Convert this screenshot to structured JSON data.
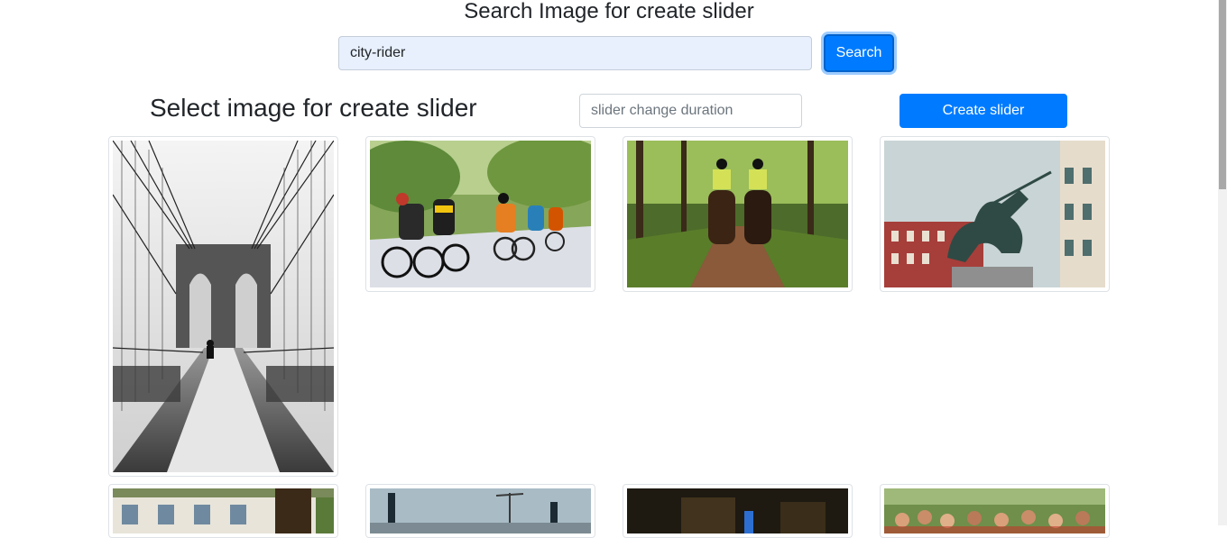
{
  "header": {
    "title": "Search Image for create slider"
  },
  "search": {
    "value": "city-rider",
    "button_label": "Search"
  },
  "slider_controls": {
    "title": "Select image for create slider",
    "duration_placeholder": "slider change duration",
    "create_label": "Create slider"
  },
  "colors": {
    "accent": "#007bff",
    "input_autofill": "#e8f0fe",
    "border": "#dee2e6"
  },
  "gallery": [
    {
      "subject": "snowy suspension bridge walkway (black & white)"
    },
    {
      "subject": "road cyclists racing"
    },
    {
      "subject": "mounted police riders on park path"
    },
    {
      "subject": "equestrian statue in city square"
    },
    {
      "subject": "building facade with windows"
    },
    {
      "subject": "street with lamp posts and bollards"
    },
    {
      "subject": "blurred night street scene"
    },
    {
      "subject": "crowd at outdoor event"
    }
  ]
}
